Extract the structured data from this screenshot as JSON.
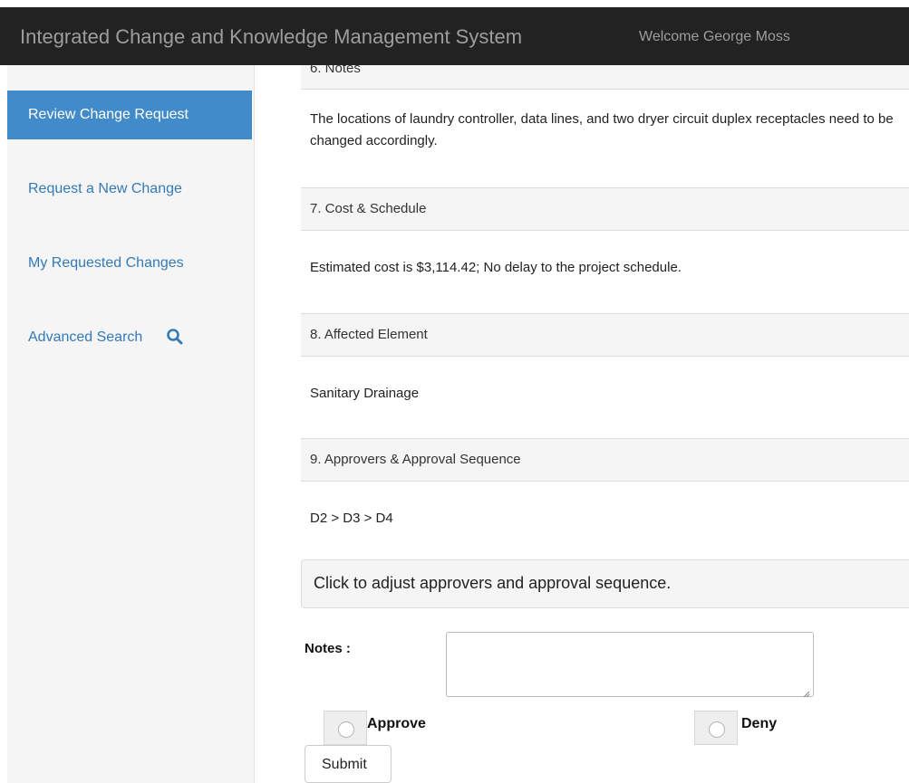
{
  "header": {
    "title": "Integrated Change and Knowledge Management System",
    "welcome": "Welcome George Moss"
  },
  "sidebar": {
    "items": [
      {
        "label": "Review Change Request",
        "active": true
      },
      {
        "label": "Request a New Change",
        "active": false
      },
      {
        "label": "My Requested Changes",
        "active": false
      },
      {
        "label": "Advanced Search",
        "active": false,
        "icon": "search-icon"
      }
    ]
  },
  "sections": {
    "cut_heading": "6. Notes",
    "notes_body": "The locations of laundry controller, data lines, and two dryer circuit duplex receptacles need to be changed accordingly.",
    "cost_heading": "7. Cost & Schedule",
    "cost_body": "Estimated cost is $3,114.42; No delay to the project schedule.",
    "element_heading": "8. Affected Element",
    "element_body": "Sanitary Drainage",
    "approvers_heading": "9. Approvers & Approval Sequence",
    "approvers_body": "D2 > D3 > D4"
  },
  "adjust": {
    "label": "Click to adjust approvers and approval sequence."
  },
  "form": {
    "notes_label": "Notes :",
    "notes_value": "",
    "approve_label": "Approve",
    "deny_label": "Deny",
    "submit_label": "Submit"
  },
  "colors": {
    "header_bg": "#222222",
    "active_nav_bg": "#428bca",
    "link": "#337ab7"
  }
}
